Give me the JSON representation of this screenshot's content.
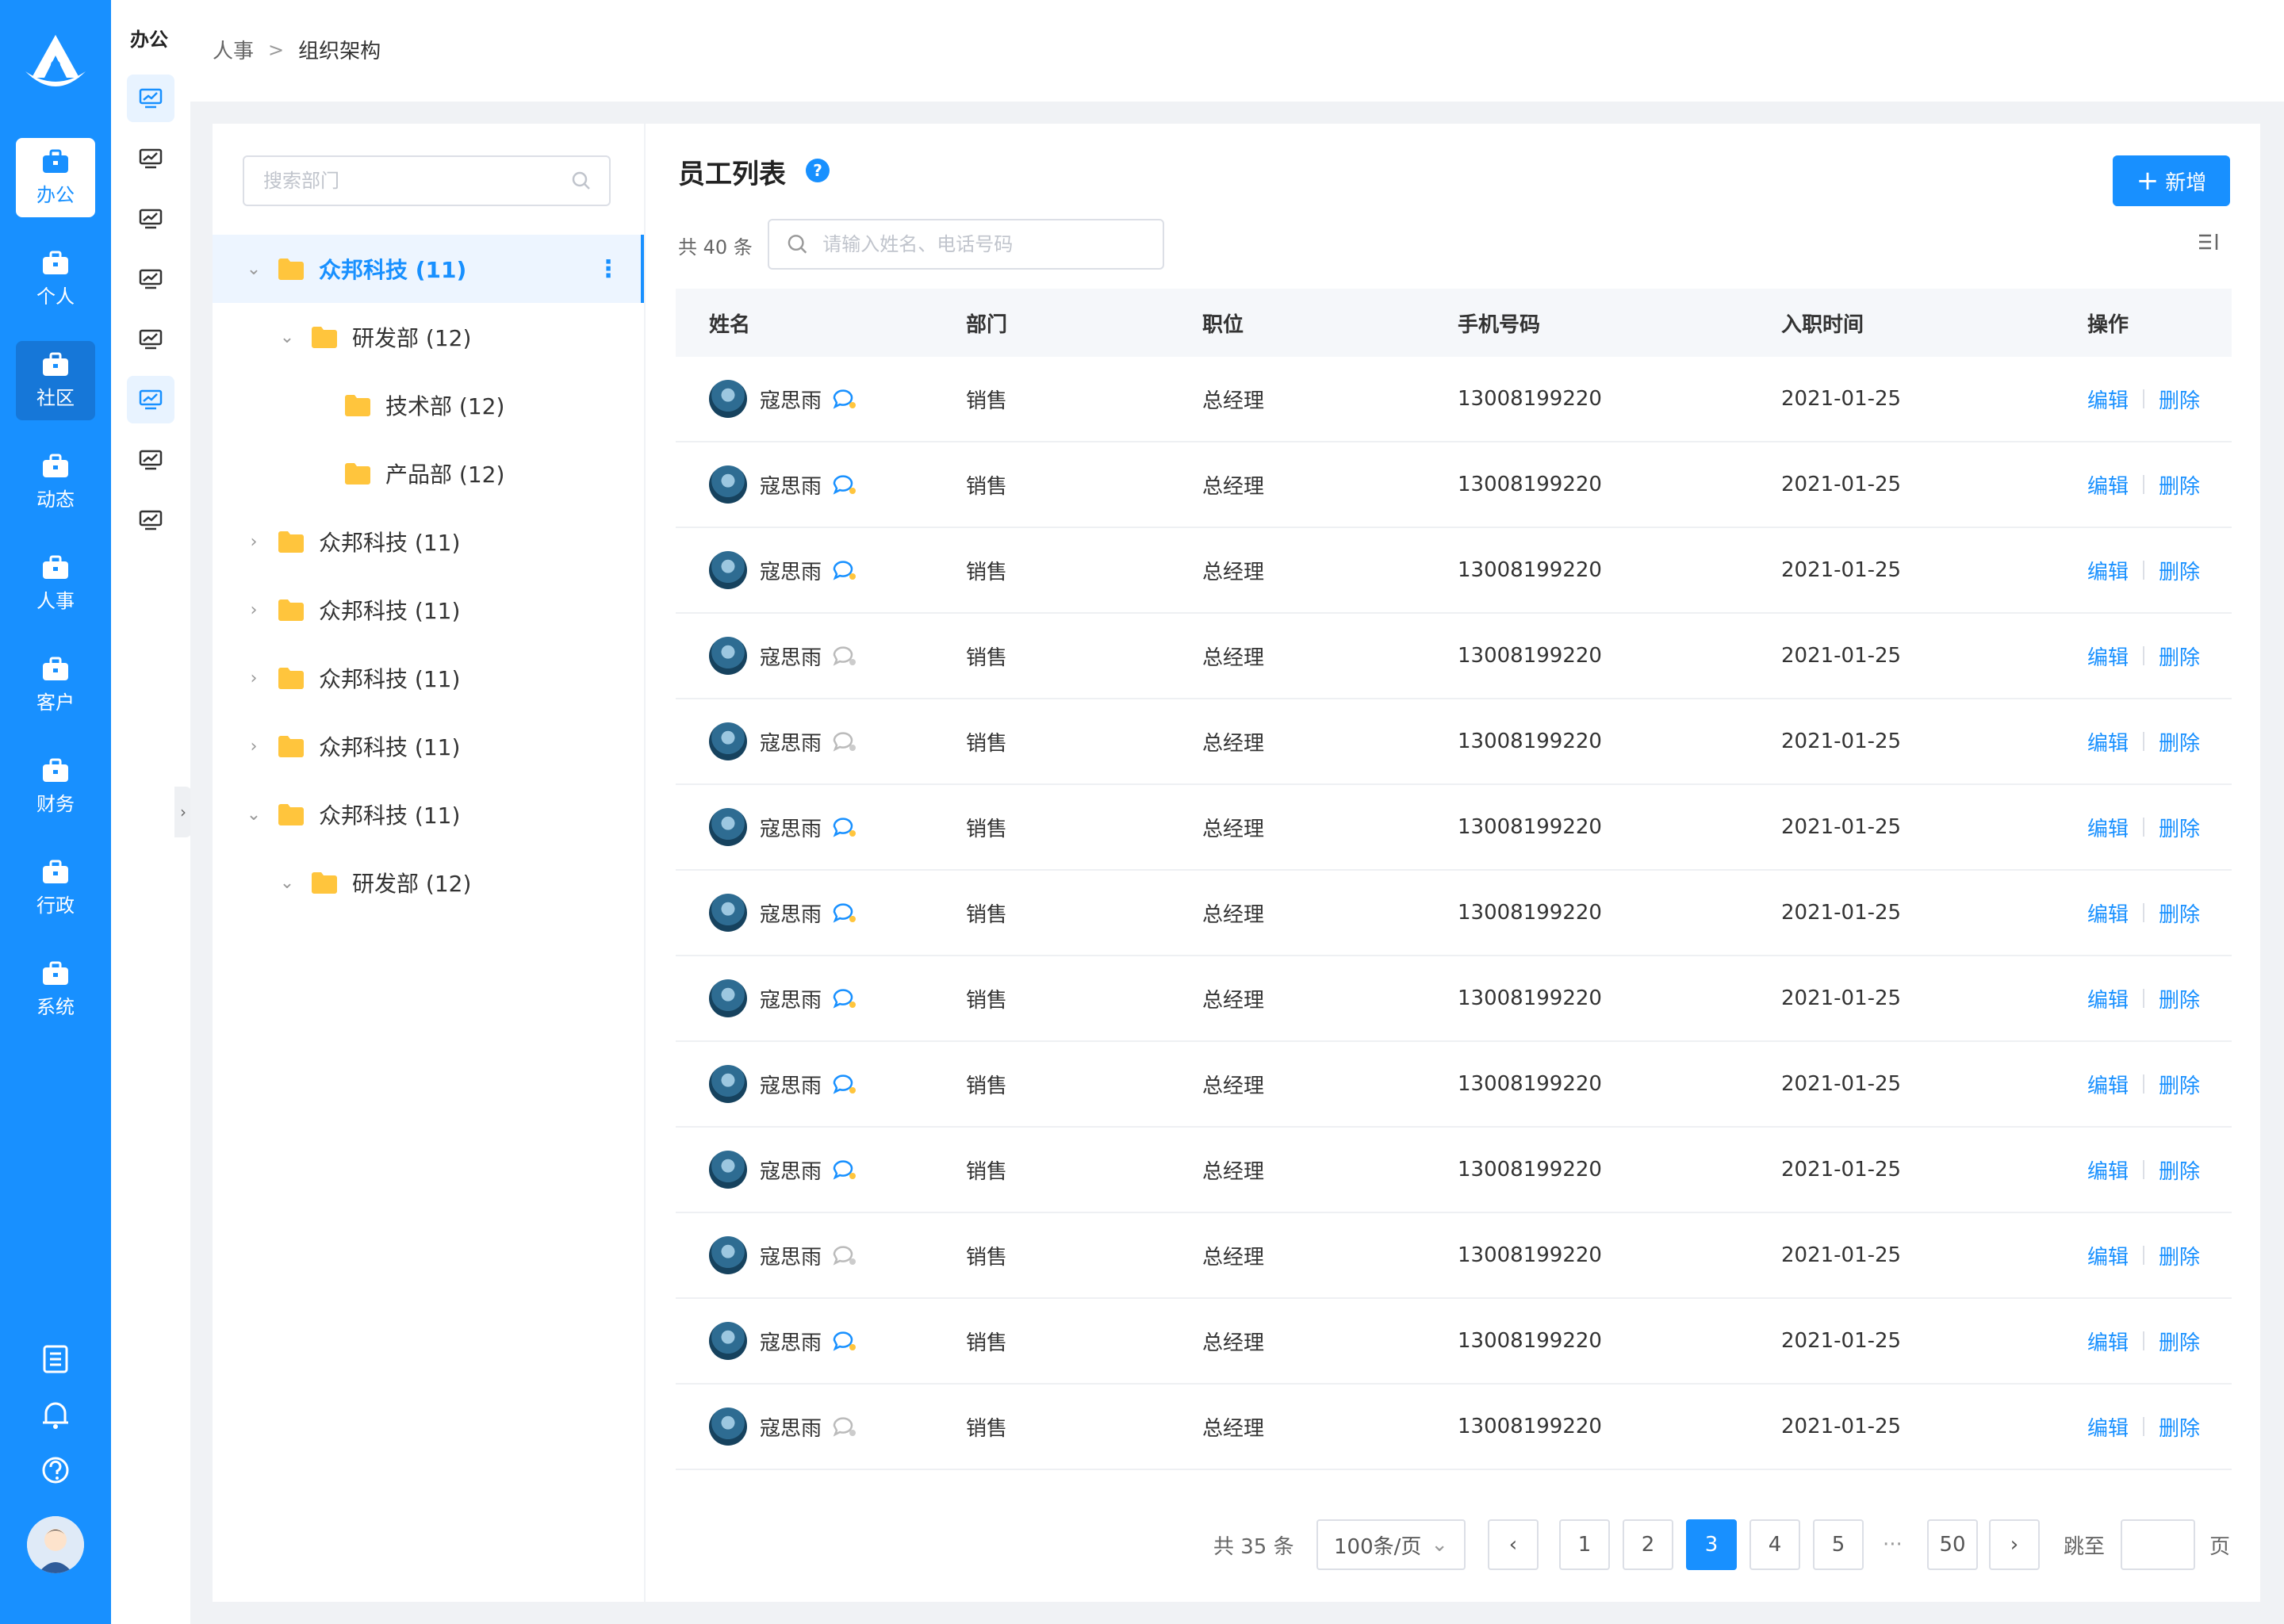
{
  "rail": {
    "items": [
      {
        "label": "办公",
        "icon": "briefcase-icon"
      },
      {
        "label": "个人",
        "icon": "briefcase-icon"
      },
      {
        "label": "社区",
        "icon": "briefcase-icon"
      },
      {
        "label": "动态",
        "icon": "briefcase-icon"
      },
      {
        "label": "人事",
        "icon": "briefcase-icon"
      },
      {
        "label": "客户",
        "icon": "briefcase-icon"
      },
      {
        "label": "财务",
        "icon": "briefcase-icon"
      },
      {
        "label": "行政",
        "icon": "briefcase-icon"
      },
      {
        "label": "系统",
        "icon": "briefcase-icon"
      }
    ],
    "bottom_icons": [
      "notes-icon",
      "bell-icon",
      "help-icon",
      "user-avatar"
    ]
  },
  "subnav": {
    "title": "办公"
  },
  "breadcrumb": {
    "parent": "人事",
    "current": "组织架构"
  },
  "dept_search": {
    "placeholder": "搜索部门"
  },
  "tree": [
    {
      "label": "众邦科技 (11)",
      "level": 0,
      "expanded": true,
      "active": true
    },
    {
      "label": "研发部 (12)",
      "level": 1,
      "expanded": true
    },
    {
      "label": "技术部 (12)",
      "level": 2
    },
    {
      "label": "产品部 (12)",
      "level": 2
    },
    {
      "label": "众邦科技 (11)",
      "level": 0,
      "expanded": false
    },
    {
      "label": "众邦科技 (11)",
      "level": 0,
      "expanded": false
    },
    {
      "label": "众邦科技 (11)",
      "level": 0,
      "expanded": false
    },
    {
      "label": "众邦科技 (11)",
      "level": 0,
      "expanded": false
    },
    {
      "label": "众邦科技 (11)",
      "level": 0,
      "expanded": true
    },
    {
      "label": "研发部 (12)",
      "level": 1,
      "expanded": true
    }
  ],
  "list": {
    "title": "员工列表",
    "help": "?",
    "add_label": "新增",
    "total_label": "共 40 条",
    "search_placeholder": "请输入姓名、电话号码"
  },
  "table": {
    "columns": [
      "姓名",
      "部门",
      "职位",
      "手机号码",
      "入职时间",
      "操作"
    ],
    "rows": [
      {
        "name": "寇思雨",
        "dept": "销售",
        "position": "总经理",
        "phone": "13008199220",
        "date": "2021-01-25",
        "chat_active": true
      },
      {
        "name": "寇思雨",
        "dept": "销售",
        "position": "总经理",
        "phone": "13008199220",
        "date": "2021-01-25",
        "chat_active": true
      },
      {
        "name": "寇思雨",
        "dept": "销售",
        "position": "总经理",
        "phone": "13008199220",
        "date": "2021-01-25",
        "chat_active": true
      },
      {
        "name": "寇思雨",
        "dept": "销售",
        "position": "总经理",
        "phone": "13008199220",
        "date": "2021-01-25",
        "chat_active": false
      },
      {
        "name": "寇思雨",
        "dept": "销售",
        "position": "总经理",
        "phone": "13008199220",
        "date": "2021-01-25",
        "chat_active": false
      },
      {
        "name": "寇思雨",
        "dept": "销售",
        "position": "总经理",
        "phone": "13008199220",
        "date": "2021-01-25",
        "chat_active": true
      },
      {
        "name": "寇思雨",
        "dept": "销售",
        "position": "总经理",
        "phone": "13008199220",
        "date": "2021-01-25",
        "chat_active": true
      },
      {
        "name": "寇思雨",
        "dept": "销售",
        "position": "总经理",
        "phone": "13008199220",
        "date": "2021-01-25",
        "chat_active": true
      },
      {
        "name": "寇思雨",
        "dept": "销售",
        "position": "总经理",
        "phone": "13008199220",
        "date": "2021-01-25",
        "chat_active": true
      },
      {
        "name": "寇思雨",
        "dept": "销售",
        "position": "总经理",
        "phone": "13008199220",
        "date": "2021-01-25",
        "chat_active": true
      },
      {
        "name": "寇思雨",
        "dept": "销售",
        "position": "总经理",
        "phone": "13008199220",
        "date": "2021-01-25",
        "chat_active": false
      },
      {
        "name": "寇思雨",
        "dept": "销售",
        "position": "总经理",
        "phone": "13008199220",
        "date": "2021-01-25",
        "chat_active": true
      },
      {
        "name": "寇思雨",
        "dept": "销售",
        "position": "总经理",
        "phone": "13008199220",
        "date": "2021-01-25",
        "chat_active": false
      }
    ],
    "edit_label": "编辑",
    "delete_label": "删除"
  },
  "pagination": {
    "total_label": "共 35 条",
    "page_size": "100条/页",
    "pages": [
      "1",
      "2",
      "3",
      "4",
      "5"
    ],
    "ellipsis": "···",
    "last": "50",
    "current": "3",
    "jump_label": "跳至",
    "page_suffix": "页"
  },
  "colors": {
    "primary": "#1890ff",
    "folder": "#ffc53d"
  }
}
